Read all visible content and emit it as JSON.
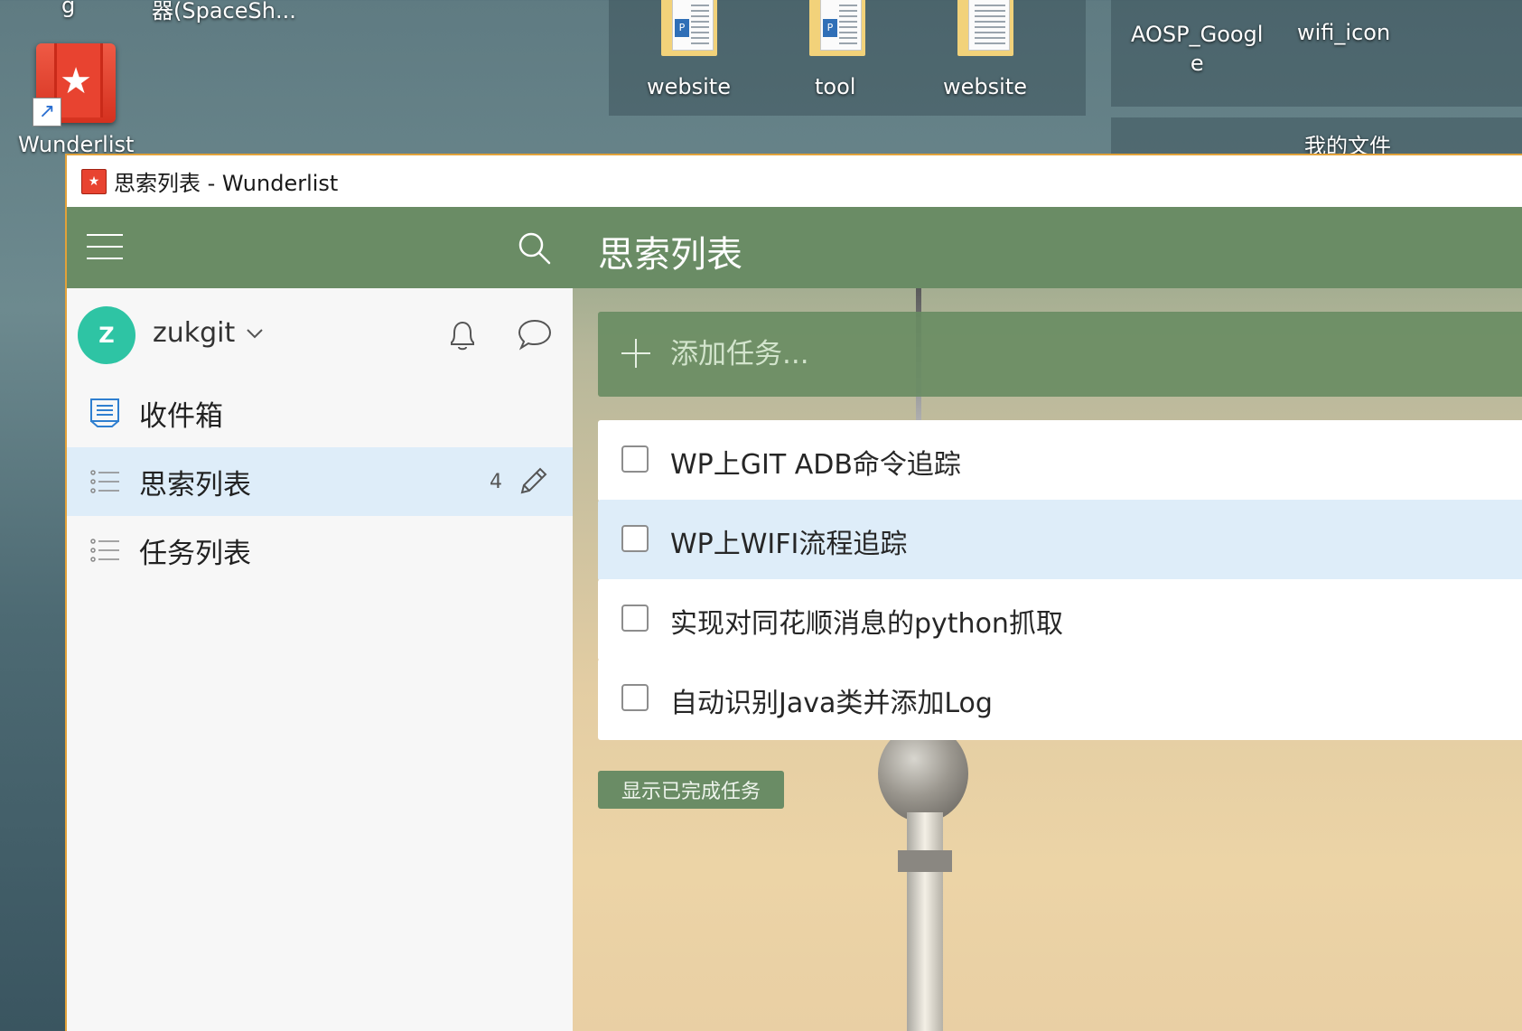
{
  "desktop": {
    "top_left_fragment": "g",
    "top_fragment": "器(SpaceSh...",
    "shortcut_label": "Wunderlist",
    "folders": [
      {
        "label": "website"
      },
      {
        "label": "tool"
      },
      {
        "label": "website"
      }
    ],
    "right_items": [
      {
        "label": "AOSP_Googl\ne"
      },
      {
        "label": "wifi_icon"
      }
    ],
    "group_label": "我的文件"
  },
  "window": {
    "title": "思索列表 - Wunderlist",
    "accent_color": "#6a8c65"
  },
  "sidebar": {
    "menu_icon": "hamburger-icon",
    "search_icon": "search-icon",
    "user": {
      "avatar_letter": "Z",
      "name": "zukgit"
    },
    "items": [
      {
        "label": "收件箱",
        "icon": "inbox-icon",
        "count": ""
      },
      {
        "label": "思索列表",
        "icon": "list-icon",
        "count": "4",
        "active": true
      },
      {
        "label": "任务列表",
        "icon": "list-icon",
        "count": ""
      }
    ]
  },
  "main": {
    "title": "思索列表",
    "add_placeholder": "添加任务...",
    "tasks": [
      {
        "title": "WP上GIT ADB命令追踪",
        "completed": false
      },
      {
        "title": "WP上WIFI流程追踪",
        "completed": false,
        "selected": true
      },
      {
        "title": "实现对同花顺消息的python抓取",
        "completed": false
      },
      {
        "title": "自动识别Java类并添加Log",
        "completed": false
      }
    ],
    "show_completed_label": "显示已完成任务"
  }
}
